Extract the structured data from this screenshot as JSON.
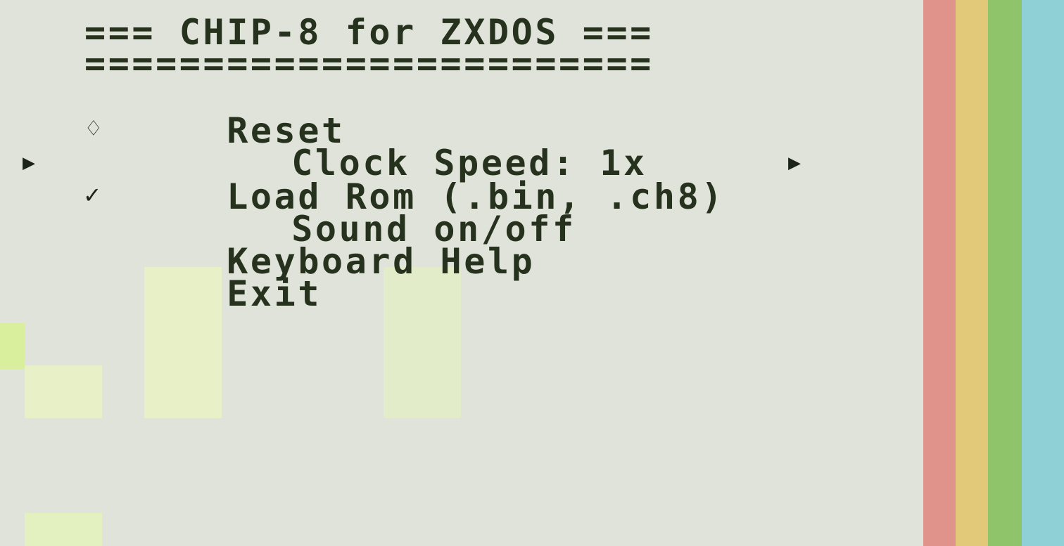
{
  "menu": {
    "title": "=== CHIP-8 for ZXDOS ===",
    "separator": "========================",
    "items": [
      {
        "label": "Reset",
        "prefix": ""
      },
      {
        "label": "Clock Speed: 1x",
        "prefix": "♢"
      },
      {
        "label": "Load Rom (.bin, .ch8)",
        "prefix": ""
      },
      {
        "label": "Sound on/off",
        "prefix": "✓"
      },
      {
        "label": "Keyboard Help",
        "prefix": ""
      },
      {
        "label": "Exit",
        "prefix": ""
      }
    ],
    "selected_index": 2,
    "cursor_left": "▶",
    "cursor_right": "▶"
  },
  "colors": {
    "background": "#dfe3d9",
    "text": "#26321d",
    "stripe_red": "#e0938a",
    "stripe_yellow": "#e2c97a",
    "stripe_green": "#8fc46a",
    "stripe_cyan": "#8fd0d6"
  }
}
